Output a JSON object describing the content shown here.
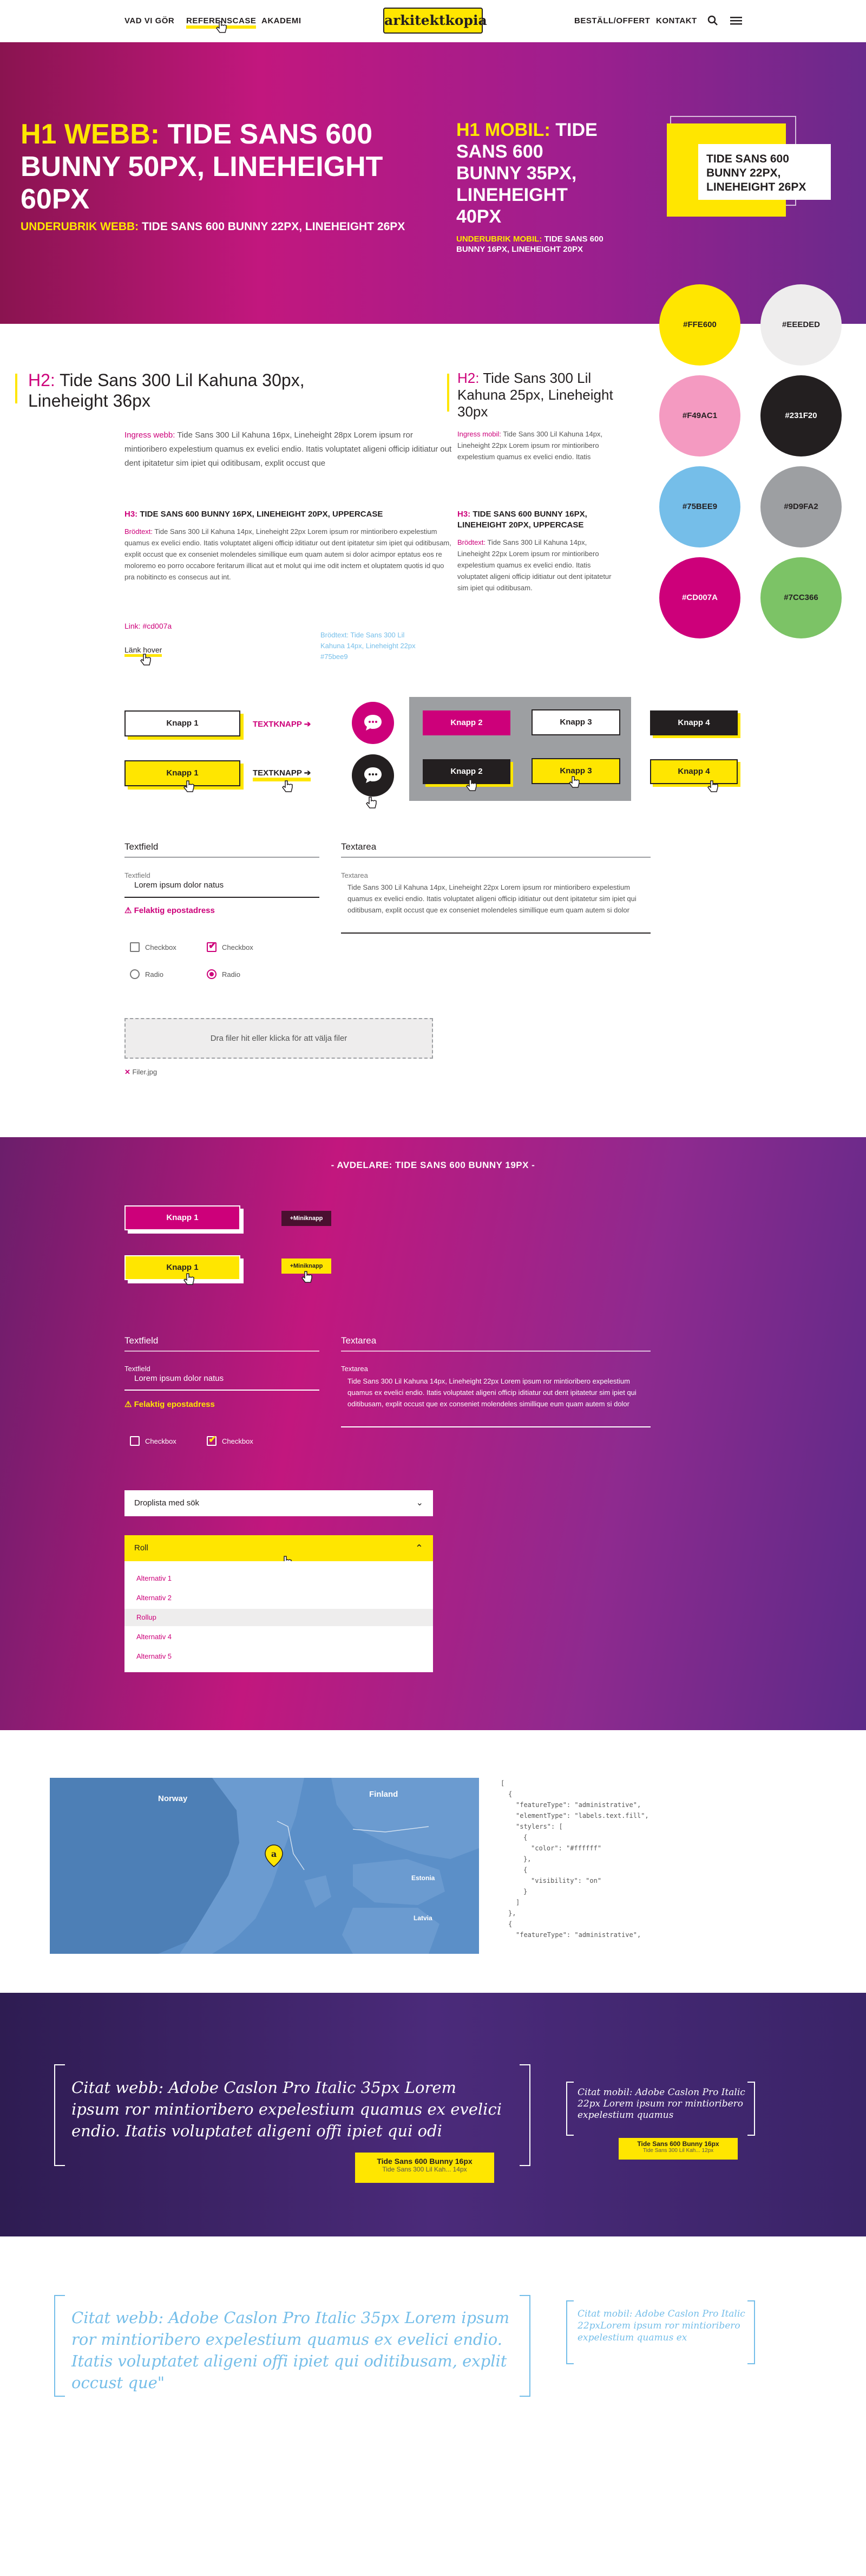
{
  "nav": {
    "left": [
      "VAD VI GÖR",
      "REFERENSCASE",
      "AKADEMI"
    ],
    "logo": "arkitektkopia",
    "right": [
      "BESTÄLL/OFFERT",
      "KONTAKT"
    ]
  },
  "hero": {
    "h1_label": "H1 WEBB:",
    "h1_text": "TIDE SANS 600 BUNNY 50PX, LINEHEIGHT 60PX",
    "sub_label": "UNDERUBRIK WEBB:",
    "sub_text": "TIDE SANS 600 BUNNY 22PX, LINEHEIGHT 26PX",
    "h1m_label": "H1 MOBIL:",
    "h1m_text": "TIDE SANS 600 BUNNY 35PX, LINEHEIGHT 40PX",
    "subm_label": "UNDERUBRIK MOBIL:",
    "subm_text": "TIDE SANS 600 BUNNY 16PX, LINEHEIGHT 20PX",
    "card_text": "TIDE SANS 600 BUNNY 22PX, LINEHEIGHT 26PX"
  },
  "swatches": [
    {
      "label": "#FFE600",
      "color": "#ffe600",
      "text": "#231f20"
    },
    {
      "label": "#EEEDED",
      "color": "#eeeded",
      "text": "#231f20"
    },
    {
      "label": "#F49AC1",
      "color": "#f49ac1",
      "text": "#231f20"
    },
    {
      "label": "#231F20",
      "color": "#231f20",
      "text": "#ffffff"
    },
    {
      "label": "#75BEE9",
      "color": "#75bee9",
      "text": "#231f20"
    },
    {
      "label": "#9D9FA2",
      "color": "#9d9fa2",
      "text": "#231f20"
    },
    {
      "label": "#CD007A",
      "color": "#cd007a",
      "text": "#ffffff"
    },
    {
      "label": "#7CC366",
      "color": "#7cc366",
      "text": "#231f20"
    }
  ],
  "typo": {
    "h2_label": "H2:",
    "h2_text": "Tide Sans 300 Lil Kahuna 30px, Lineheight 36px",
    "h2m_label": "H2:",
    "h2m_text": "Tide Sans 300 Lil Kahuna 25px, Lineheight 30px",
    "ingress_label": "Ingress webb:",
    "ingress_text": "Tide Sans 300 Lil Kahuna 16px, Lineheight 28px Lorem ipsum ror mintioribero expelestium quamus ex evelici endio. Itatis voluptatet aligeni officip iditiatur out dent ipitatetur sim ipiet qui oditibusam, explit occust que",
    "ingressm_label": "Ingress mobil:",
    "ingressm_text": "Tide Sans 300 Lil Kahuna 14px, Lineheight 22px Lorem ipsum ror mintioribero expelestium quamus ex evelici endio. Itatis",
    "h3_label": "H3:",
    "h3_text": "TIDE SANS 600 BUNNY 16PX, LINEHEIGHT 20PX, UPPERCASE",
    "bread_label": "Brödtext:",
    "bread_text": "Tide Sans 300 Lil Kahuna 14px, Lineheight 22px Lorem ipsum ror mintioribero expelestium quamus ex evelici endio. Itatis voluptatet aligeni officip iditiatur out dent ipitatetur sim ipiet qui oditibusam, explit occust que ex conseniet molendeles simillique eum quam autem si dolor acimpor eptatus eos re moloremo eo porro occabore feritarum illicat aut et molut qui ime odit inctem et oluptatem quotis id quo pra nobitincto es consecus aut int.",
    "h3m_label": "H3:",
    "h3m_text": "TIDE SANS 600 BUNNY 16PX, LINEHEIGHT 20PX, UPPERCASE",
    "breadm_label": "Brödtext:",
    "breadm_text": "Tide Sans 300 Lil Kahuna 14px, Lineheight 22px Lorem ipsum ror mintioribero expelestium quamus ex evelici endio. Itatis voluptatet aligeni officip iditiatur out dent ipitatetur sim ipiet qui oditibusam.",
    "link": "Link: #cd007a",
    "link_hover": "Länk hover",
    "bread_blue": "Brödtext: Tide Sans 300 Lil Kahuna 14px, Lineheight 22px #75bee9"
  },
  "buttons": {
    "knapp1": "Knapp 1",
    "textknapp": "TEXTKNAPP",
    "knapp2": "Knapp 2",
    "knapp3": "Knapp 3",
    "knapp4": "Knapp 4"
  },
  "form": {
    "textfield": "Textfield",
    "textarea": "Textarea",
    "textfield_label": "Textfield",
    "textfield_value": "Lorem ipsum dolor natus",
    "error": "Felaktig epostadress",
    "textarea_label": "Textarea",
    "textarea_value": "Tide Sans 300 Lil Kahuna 14px, Lineheight 22px Lorem ipsum ror mintioribero expelestium quamus ex evelici endio. Itatis voluptatet aligeni officip iditiatur out dent ipitatetur sim ipiet qui oditibusam, explit occust que ex conseniet molendeles simillique eum quam autem si dolor",
    "checkbox": "Checkbox",
    "radio": "Radio",
    "dropzone": "Dra filer hit eller klicka för att välja filer",
    "file": "Filer.jpg"
  },
  "section2": {
    "title": "- AVDELARE: TIDE SANS 600 BUNNY 19PX -",
    "knapp1": "Knapp 1",
    "miniknapp": "+Miniknapp",
    "textfield": "Textfield",
    "textarea": "Textarea",
    "textfield_label": "Textfield",
    "textfield_value": "Lorem ipsum dolor natus",
    "error": "Felaktig epostadress",
    "textarea_label": "Textarea",
    "textarea_value": "Tide Sans 300 Lil Kahuna 14px, Lineheight 22px Lorem ipsum ror mintioribero expelestium quamus ex evelici endio. Itatis voluptatet aligeni officip iditiatur out dent ipitatetur sim ipiet qui oditibusam, explit occust que ex conseniet molendeles simillique eum quam autem si dolor",
    "checkbox": "Checkbox",
    "dropdown1": "Droplista med sök",
    "dropdown2": "Roll",
    "options": [
      "Alternativ 1",
      "Alternativ 2",
      "Rollup",
      "Alternativ 4",
      "Alternativ 5"
    ]
  },
  "map": {
    "labels": [
      "Norway",
      "Finland",
      "Estonia",
      "Latvia"
    ],
    "code": [
      "[",
      "{",
      "\"featureType\": \"administrative\",",
      "\"elementType\": \"labels.text.fill\",",
      "\"stylers\": [",
      "{",
      "\"color\": \"#ffffff\"",
      "},",
      "{",
      "\"visibility\": \"on\"",
      "}",
      "]",
      "},",
      "{",
      "\"featureType\": \"administrative\","
    ]
  },
  "quotes": {
    "web": "Citat webb: Adobe Caslon Pro Italic 35px Lorem ipsum ror mintioribero expelestium quamus ex evelici endio. Itatis voluptatet aligeni offi ipiet qui odi",
    "web_tag1": "Tide Sans 600 Bunny 16px",
    "web_tag2": "Tide Sans 300 Lil Kah... 14px",
    "mob": "Citat mobil: Adobe Caslon Pro Italic 22px Lorem ipsum ror mintioribero expelestium quamus",
    "mob_tag1": "Tide Sans 600 Bunny 16px",
    "mob_tag2": "Tide Sans 300 Lil Kah... 12px",
    "web2": "Citat webb: Adobe Caslon Pro Italic 35px Lorem ipsum ror mintioribero expelestium quamus ex evelici endio. Itatis voluptatet aligeni offi ipiet qui oditibusam, explit occust que\"",
    "mob2": "Citat mobil: Adobe Caslon Pro Italic 22pxLorem ipsum ror mintioribero expelestium quamus ex"
  },
  "colors": {
    "yellow": "#ffe600",
    "magenta": "#cd007a",
    "dark": "#231f20",
    "lightblue": "#75bee9"
  }
}
